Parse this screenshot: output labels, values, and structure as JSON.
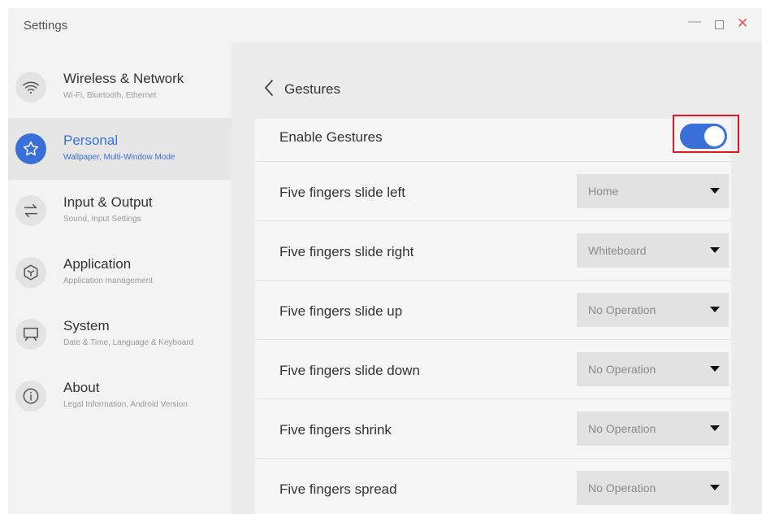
{
  "window": {
    "title": "Settings",
    "controls": {
      "minimize": "—",
      "close": "✕"
    }
  },
  "sidebar": {
    "items": [
      {
        "label": "Wireless & Network",
        "sub": "Wi-Fi, Bluetooth, Ethernet",
        "icon": "wifi-icon",
        "active": false
      },
      {
        "label": "Personal",
        "sub": "Wallpaper, Multi-Window Mode",
        "icon": "star-icon",
        "active": true
      },
      {
        "label": "Input & Output",
        "sub": "Sound, Input Settings",
        "icon": "arrows-swap-icon",
        "active": false
      },
      {
        "label": "Application",
        "sub": "Application management",
        "icon": "cube-icon",
        "active": false
      },
      {
        "label": "System",
        "sub": "Date & Time, Language & Keyboard",
        "icon": "monitor-icon",
        "active": false
      },
      {
        "label": "About",
        "sub": "Legal Information, Android Version",
        "icon": "info-icon",
        "active": false
      }
    ]
  },
  "content": {
    "title": "Gestures",
    "enable": {
      "label": "Enable Gestures",
      "on": true
    },
    "gestures": [
      {
        "label": "Five fingers slide left",
        "value": "Home"
      },
      {
        "label": "Five fingers slide right",
        "value": "Whiteboard"
      },
      {
        "label": "Five fingers slide up",
        "value": "No Operation"
      },
      {
        "label": "Five fingers slide down",
        "value": "No Operation"
      },
      {
        "label": "Five fingers shrink",
        "value": "No Operation"
      },
      {
        "label": "Five fingers spread",
        "value": "No Operation"
      }
    ]
  },
  "colors": {
    "accent": "#3b6fd8",
    "highlight": "#e0181f"
  }
}
